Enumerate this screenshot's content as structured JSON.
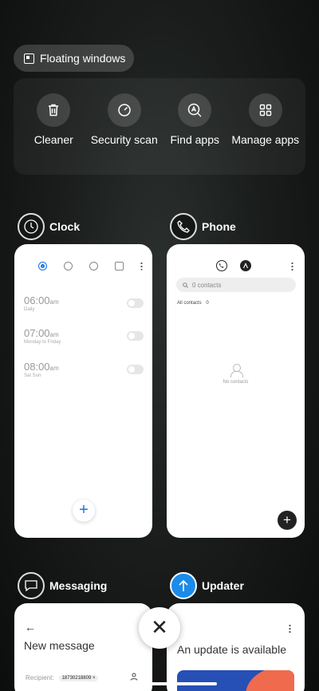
{
  "floating": {
    "label": "Floating windows"
  },
  "tools": [
    {
      "label": "Cleaner",
      "icon": "trash-icon"
    },
    {
      "label": "Security scan",
      "icon": "shield-gauge-icon"
    },
    {
      "label": "Find apps",
      "icon": "find-apps-icon"
    },
    {
      "label": "Manage apps",
      "icon": "grid-icon"
    }
  ],
  "apps": {
    "clock": {
      "name": "Clock",
      "alarms": [
        {
          "time": "06:00",
          "ampm": "am",
          "repeat": "Daily"
        },
        {
          "time": "07:00",
          "ampm": "am",
          "repeat": "Monday to Friday"
        },
        {
          "time": "08:00",
          "ampm": "am",
          "repeat": "Sat Sun"
        }
      ],
      "fab": "+"
    },
    "phone": {
      "name": "Phone",
      "search_placeholder": "0 contacts",
      "all_contacts": "All contacts",
      "count": "0",
      "empty_text": "No contacts",
      "fab": "+"
    },
    "messaging": {
      "name": "Messaging",
      "back": "←",
      "title": "New message",
      "recipient_label": "Recipient:",
      "recipient_value": "18730218809 ×"
    },
    "updater": {
      "name": "Updater",
      "title": "An update is available"
    }
  },
  "close": "✕"
}
